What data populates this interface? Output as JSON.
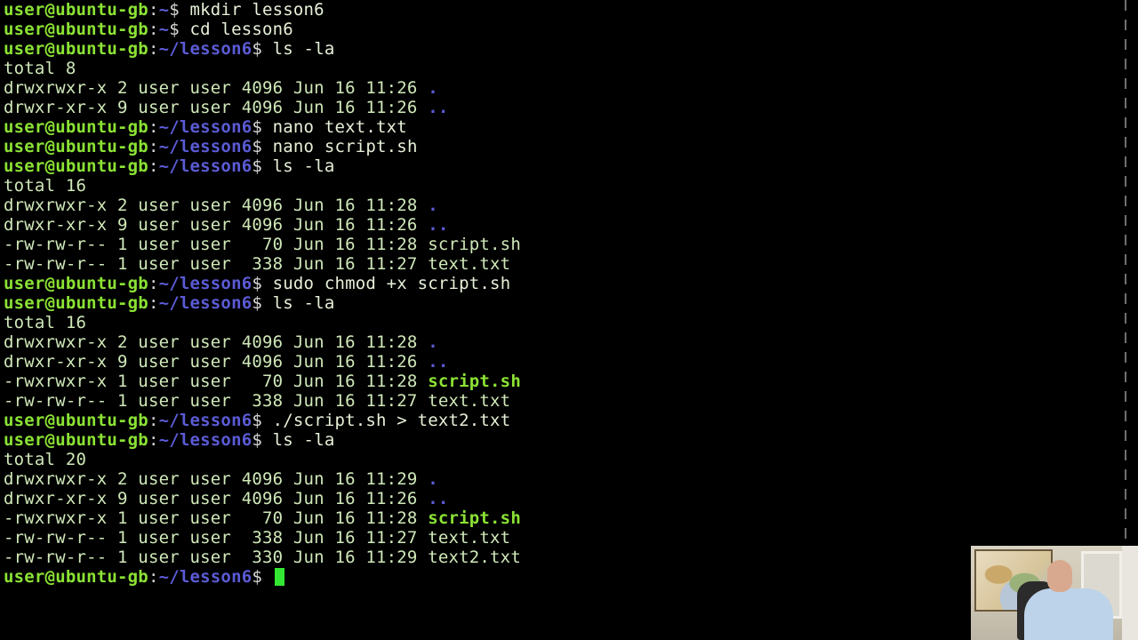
{
  "prompt": {
    "user_host": "user@ubuntu-gb",
    "home": "~",
    "cwd": "~/lesson6",
    "sep": ":",
    "dollar": "$"
  },
  "lines": [
    {
      "type": "prompt",
      "path": "~",
      "cmd": "mkdir lesson6"
    },
    {
      "type": "prompt",
      "path": "~",
      "cmd": "cd lesson6"
    },
    {
      "type": "prompt",
      "path": "~/lesson6",
      "cmd": "ls -la"
    },
    {
      "type": "out",
      "text": "total 8"
    },
    {
      "type": "ls",
      "text": "drwxrwxr-x 2 user user 4096 Jun 16 11:26 ",
      "name": ".",
      "kind": "dir"
    },
    {
      "type": "ls",
      "text": "drwxr-xr-x 9 user user 4096 Jun 16 11:26 ",
      "name": "..",
      "kind": "dir"
    },
    {
      "type": "prompt",
      "path": "~/lesson6",
      "cmd": "nano text.txt"
    },
    {
      "type": "prompt",
      "path": "~/lesson6",
      "cmd": "nano script.sh"
    },
    {
      "type": "prompt",
      "path": "~/lesson6",
      "cmd": "ls -la"
    },
    {
      "type": "out",
      "text": "total 16"
    },
    {
      "type": "ls",
      "text": "drwxrwxr-x 2 user user 4096 Jun 16 11:28 ",
      "name": ".",
      "kind": "dir"
    },
    {
      "type": "ls",
      "text": "drwxr-xr-x 9 user user 4096 Jun 16 11:26 ",
      "name": "..",
      "kind": "dir"
    },
    {
      "type": "ls",
      "text": "-rw-rw-r-- 1 user user   70 Jun 16 11:28 ",
      "name": "script.sh",
      "kind": "file"
    },
    {
      "type": "ls",
      "text": "-rw-rw-r-- 1 user user  338 Jun 16 11:27 ",
      "name": "text.txt",
      "kind": "file"
    },
    {
      "type": "prompt",
      "path": "~/lesson6",
      "cmd": "sudo chmod +x script.sh"
    },
    {
      "type": "prompt",
      "path": "~/lesson6",
      "cmd": "ls -la"
    },
    {
      "type": "out",
      "text": "total 16"
    },
    {
      "type": "ls",
      "text": "drwxrwxr-x 2 user user 4096 Jun 16 11:28 ",
      "name": ".",
      "kind": "dir"
    },
    {
      "type": "ls",
      "text": "drwxr-xr-x 9 user user 4096 Jun 16 11:26 ",
      "name": "..",
      "kind": "dir"
    },
    {
      "type": "ls",
      "text": "-rwxrwxr-x 1 user user   70 Jun 16 11:28 ",
      "name": "script.sh",
      "kind": "exe"
    },
    {
      "type": "ls",
      "text": "-rw-rw-r-- 1 user user  338 Jun 16 11:27 ",
      "name": "text.txt",
      "kind": "file"
    },
    {
      "type": "prompt",
      "path": "~/lesson6",
      "cmd": "./script.sh > text2.txt"
    },
    {
      "type": "prompt",
      "path": "~/lesson6",
      "cmd": "ls -la"
    },
    {
      "type": "out",
      "text": "total 20"
    },
    {
      "type": "ls",
      "text": "drwxrwxr-x 2 user user 4096 Jun 16 11:29 ",
      "name": ".",
      "kind": "dir"
    },
    {
      "type": "ls",
      "text": "drwxr-xr-x 9 user user 4096 Jun 16 11:26 ",
      "name": "..",
      "kind": "dir"
    },
    {
      "type": "ls",
      "text": "-rwxrwxr-x 1 user user   70 Jun 16 11:28 ",
      "name": "script.sh",
      "kind": "exe"
    },
    {
      "type": "ls",
      "text": "-rw-rw-r-- 1 user user  338 Jun 16 11:27 ",
      "name": "text.txt",
      "kind": "file"
    },
    {
      "type": "ls",
      "text": "-rw-rw-r-- 1 user user  330 Jun 16 11:29 ",
      "name": "text2.txt",
      "kind": "file"
    },
    {
      "type": "prompt",
      "path": "~/lesson6",
      "cmd": "",
      "cursor": true
    }
  ],
  "webcam": {
    "icon": "webcam-person"
  },
  "colors": {
    "background": "#000000",
    "user_host": "#8be234",
    "path": "#5b5bd6",
    "cursor": "#33e833"
  }
}
